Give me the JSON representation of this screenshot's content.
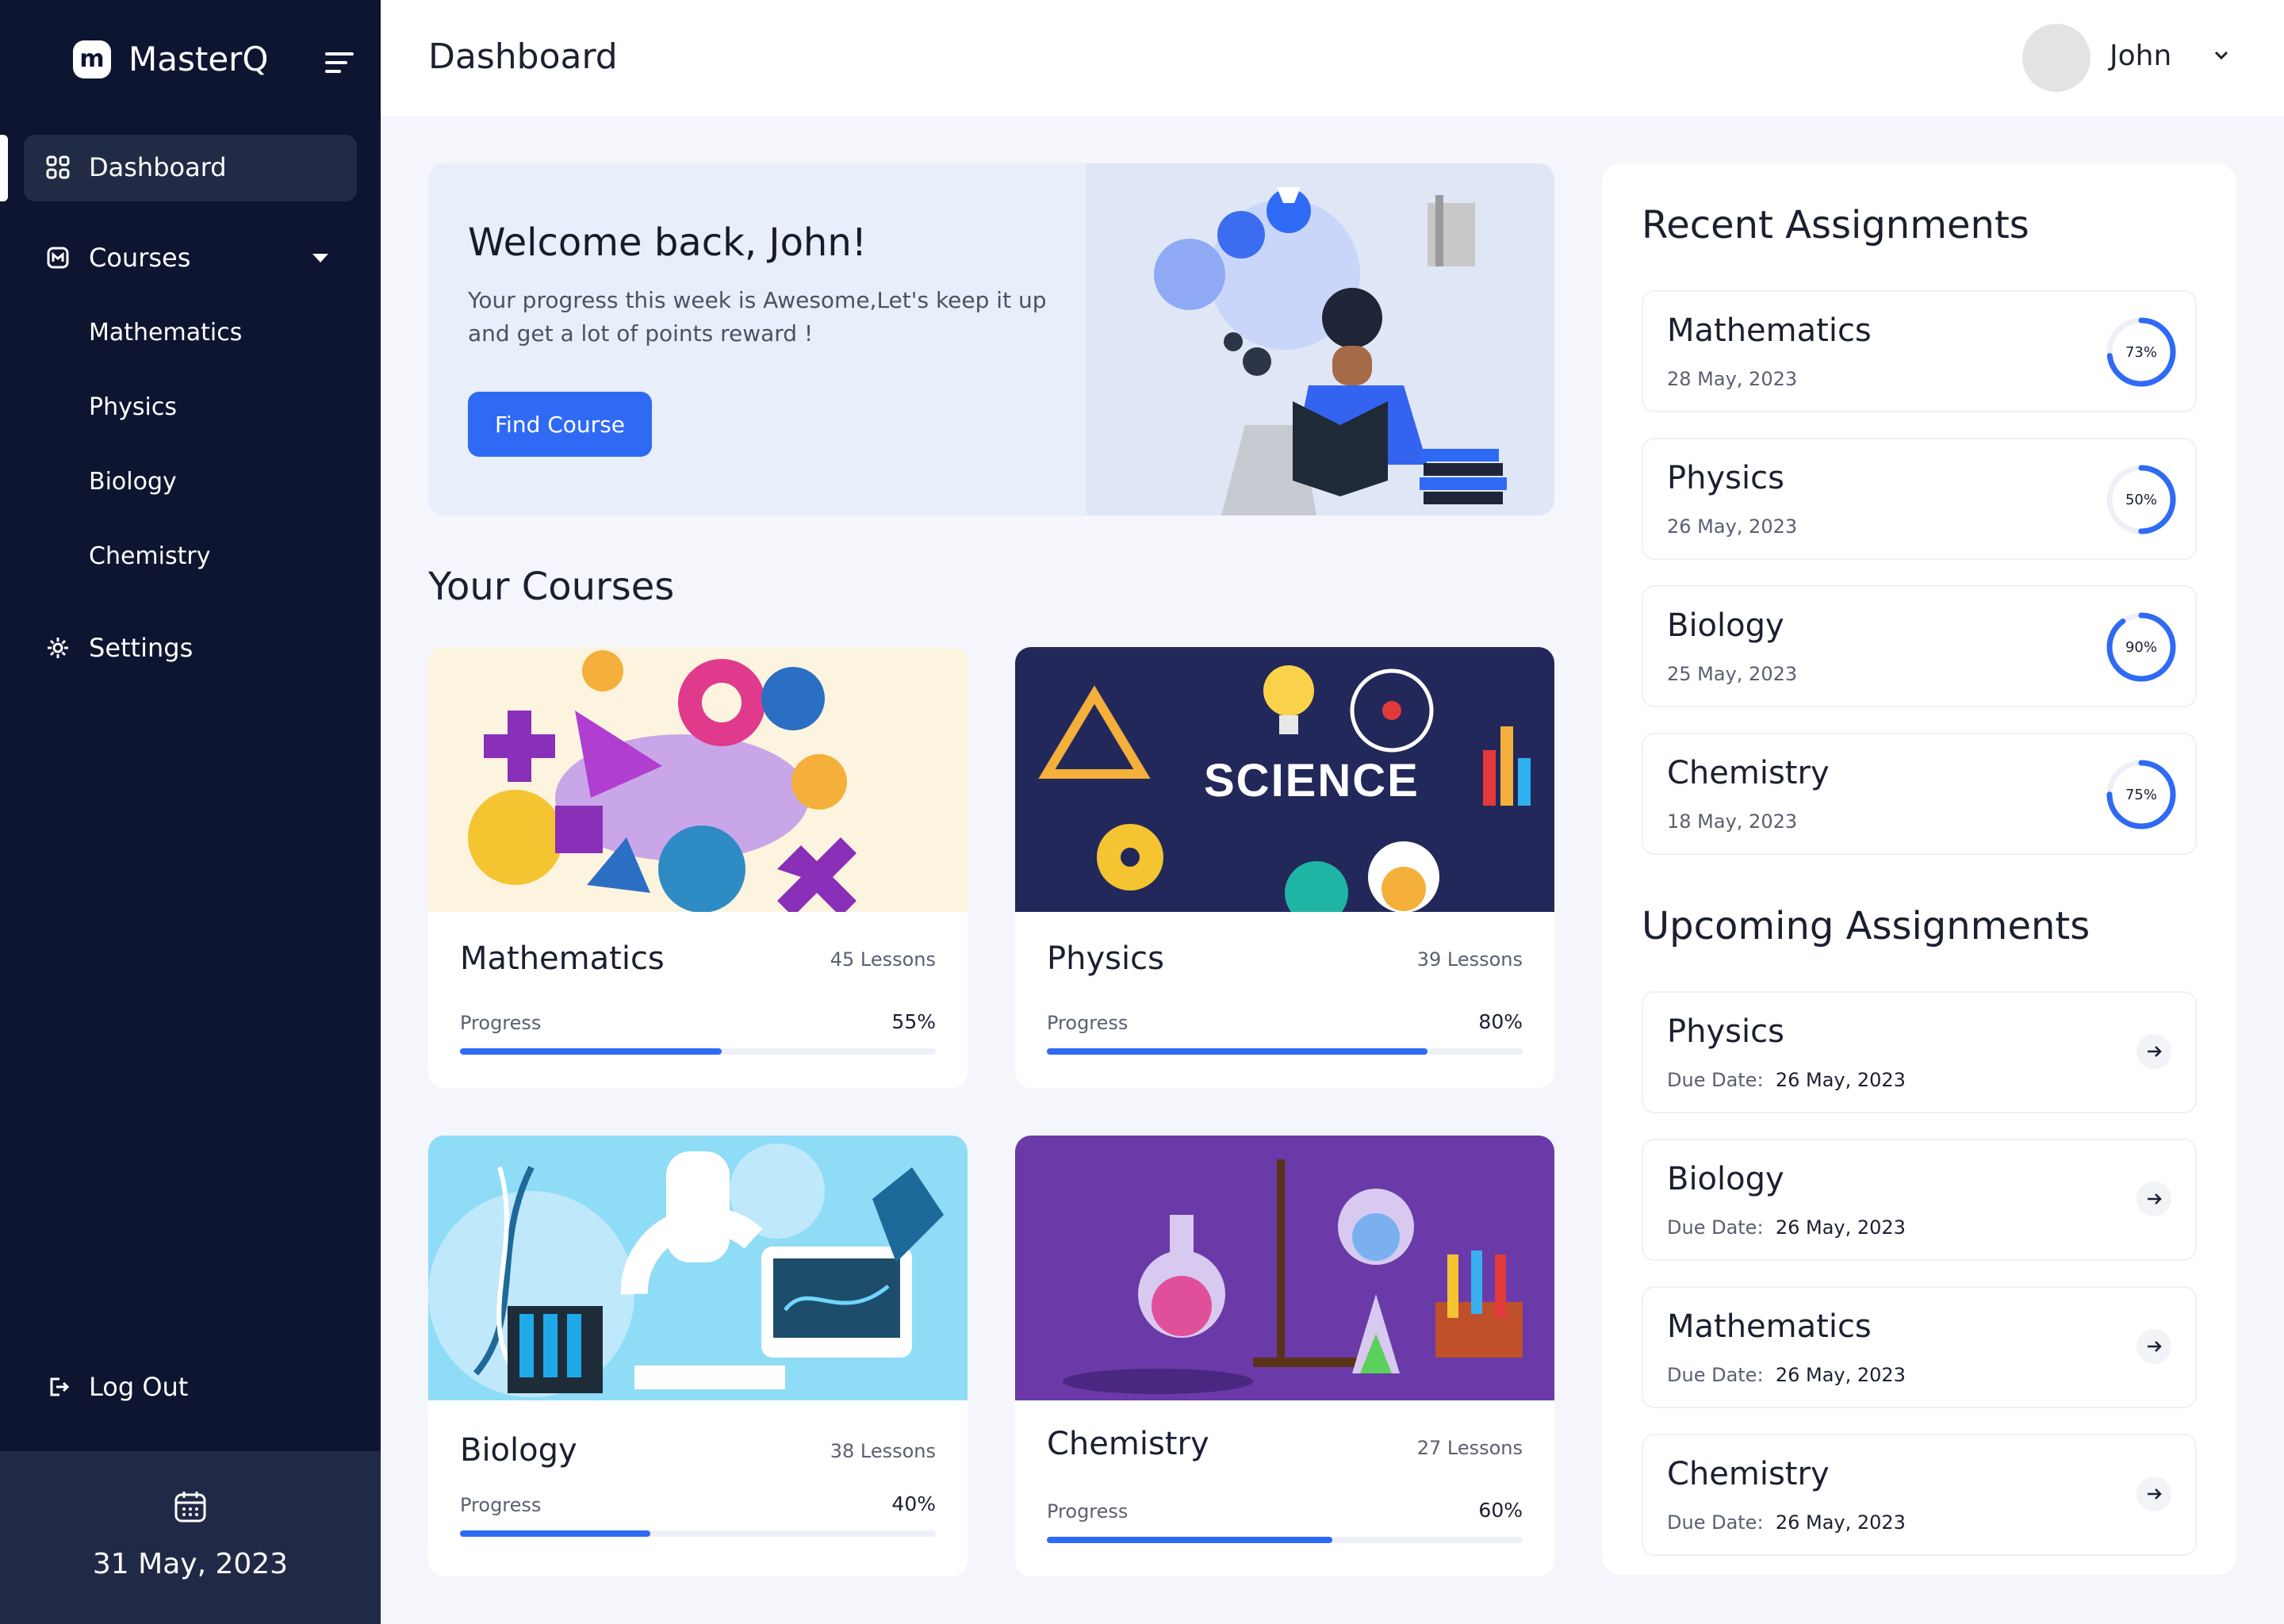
{
  "app": {
    "name": "MasterQ",
    "logo_letter": "m"
  },
  "sidebar": {
    "dashboard": "Dashboard",
    "courses": "Courses",
    "sub_items": [
      "Mathematics",
      "Physics",
      "Biology",
      "Chemistry"
    ],
    "settings": "Settings",
    "logout": "Log Out",
    "date": "31 May, 2023"
  },
  "header": {
    "title": "Dashboard",
    "user": "John"
  },
  "banner": {
    "title": "Welcome back, John!",
    "subtitle": "Your progress this week is Awesome,Let's keep it up and get a lot of points reward !",
    "button": "Find Course"
  },
  "courses": {
    "title": "Your Courses",
    "progress_label": "Progress",
    "items": [
      {
        "name": "Mathematics",
        "lessons": "45 Lessons",
        "progress": "55%",
        "progress_value": 0.55
      },
      {
        "name": "Physics",
        "lessons": "39 Lessons",
        "progress": "80%",
        "progress_value": 0.8
      },
      {
        "name": "Biology",
        "lessons": "38 Lessons",
        "progress": "40%",
        "progress_value": 0.4
      },
      {
        "name": "Chemistry",
        "lessons": "27 Lessons",
        "progress": "60%",
        "progress_value": 0.6
      }
    ]
  },
  "recent": {
    "title": "Recent Assignments",
    "items": [
      {
        "name": "Mathematics",
        "date": "28 May, 2023",
        "percent": "73%",
        "value": 0.73
      },
      {
        "name": "Physics",
        "date": "26 May, 2023",
        "percent": "50%",
        "value": 0.5
      },
      {
        "name": "Biology",
        "date": "25 May, 2023",
        "percent": "90%",
        "value": 0.9
      },
      {
        "name": "Chemistry",
        "date": "18 May, 2023",
        "percent": "75%",
        "value": 0.75
      }
    ]
  },
  "upcoming": {
    "title": "Upcoming Assignments",
    "due_label": "Due Date:",
    "items": [
      {
        "name": "Physics",
        "due": "26 May, 2023"
      },
      {
        "name": "Biology",
        "due": "26 May, 2023"
      },
      {
        "name": "Mathematics",
        "due": "26 May, 2023"
      },
      {
        "name": "Chemistry",
        "due": "26 May, 2023"
      }
    ]
  },
  "colors": {
    "sidebar": "#0d1530",
    "accent": "#2f6af5",
    "ring_track": "#eef0f8"
  }
}
